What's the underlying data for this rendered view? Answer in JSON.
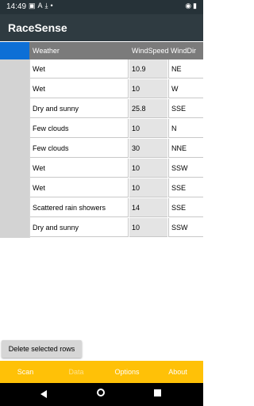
{
  "status_bar": {
    "time": "14:49",
    "left_icons": [
      "gmail-icon",
      "text-icon",
      "download-icon",
      "dot-icon"
    ],
    "right_icons": [
      "wifi-icon",
      "battery-icon"
    ]
  },
  "app": {
    "title": "RaceSense"
  },
  "table": {
    "columns": [
      "Weather",
      "WindSpeed",
      "WindDir"
    ],
    "rows": [
      {
        "weather": "Wet",
        "windspeed": "10.9",
        "winddir": "NE"
      },
      {
        "weather": "Wet",
        "windspeed": "10",
        "winddir": "W"
      },
      {
        "weather": "Dry and sunny",
        "windspeed": "25.8",
        "winddir": "SSE"
      },
      {
        "weather": "Few clouds",
        "windspeed": "10",
        "winddir": "N"
      },
      {
        "weather": "Few clouds",
        "windspeed": "30",
        "winddir": "NNE"
      },
      {
        "weather": "Wet",
        "windspeed": "10",
        "winddir": "SSW"
      },
      {
        "weather": "Wet",
        "windspeed": "10",
        "winddir": "SSE"
      },
      {
        "weather": "Scattered rain showers",
        "windspeed": "14",
        "winddir": "SSE"
      },
      {
        "weather": "Dry and sunny",
        "windspeed": "10",
        "winddir": "SSW"
      }
    ]
  },
  "actions": {
    "delete_label": "Delete selected rows"
  },
  "bottom_nav": {
    "items": [
      {
        "label": "Scan",
        "enabled": true
      },
      {
        "label": "Data",
        "enabled": false
      },
      {
        "label": "Options",
        "enabled": true
      },
      {
        "label": "About",
        "enabled": true
      }
    ]
  },
  "colors": {
    "status_bar": "#263238",
    "app_bar": "#2f3b41",
    "header_row": "#7b7b7b",
    "select_header": "#0d6fd6",
    "bottom_nav": "#ffc107"
  }
}
